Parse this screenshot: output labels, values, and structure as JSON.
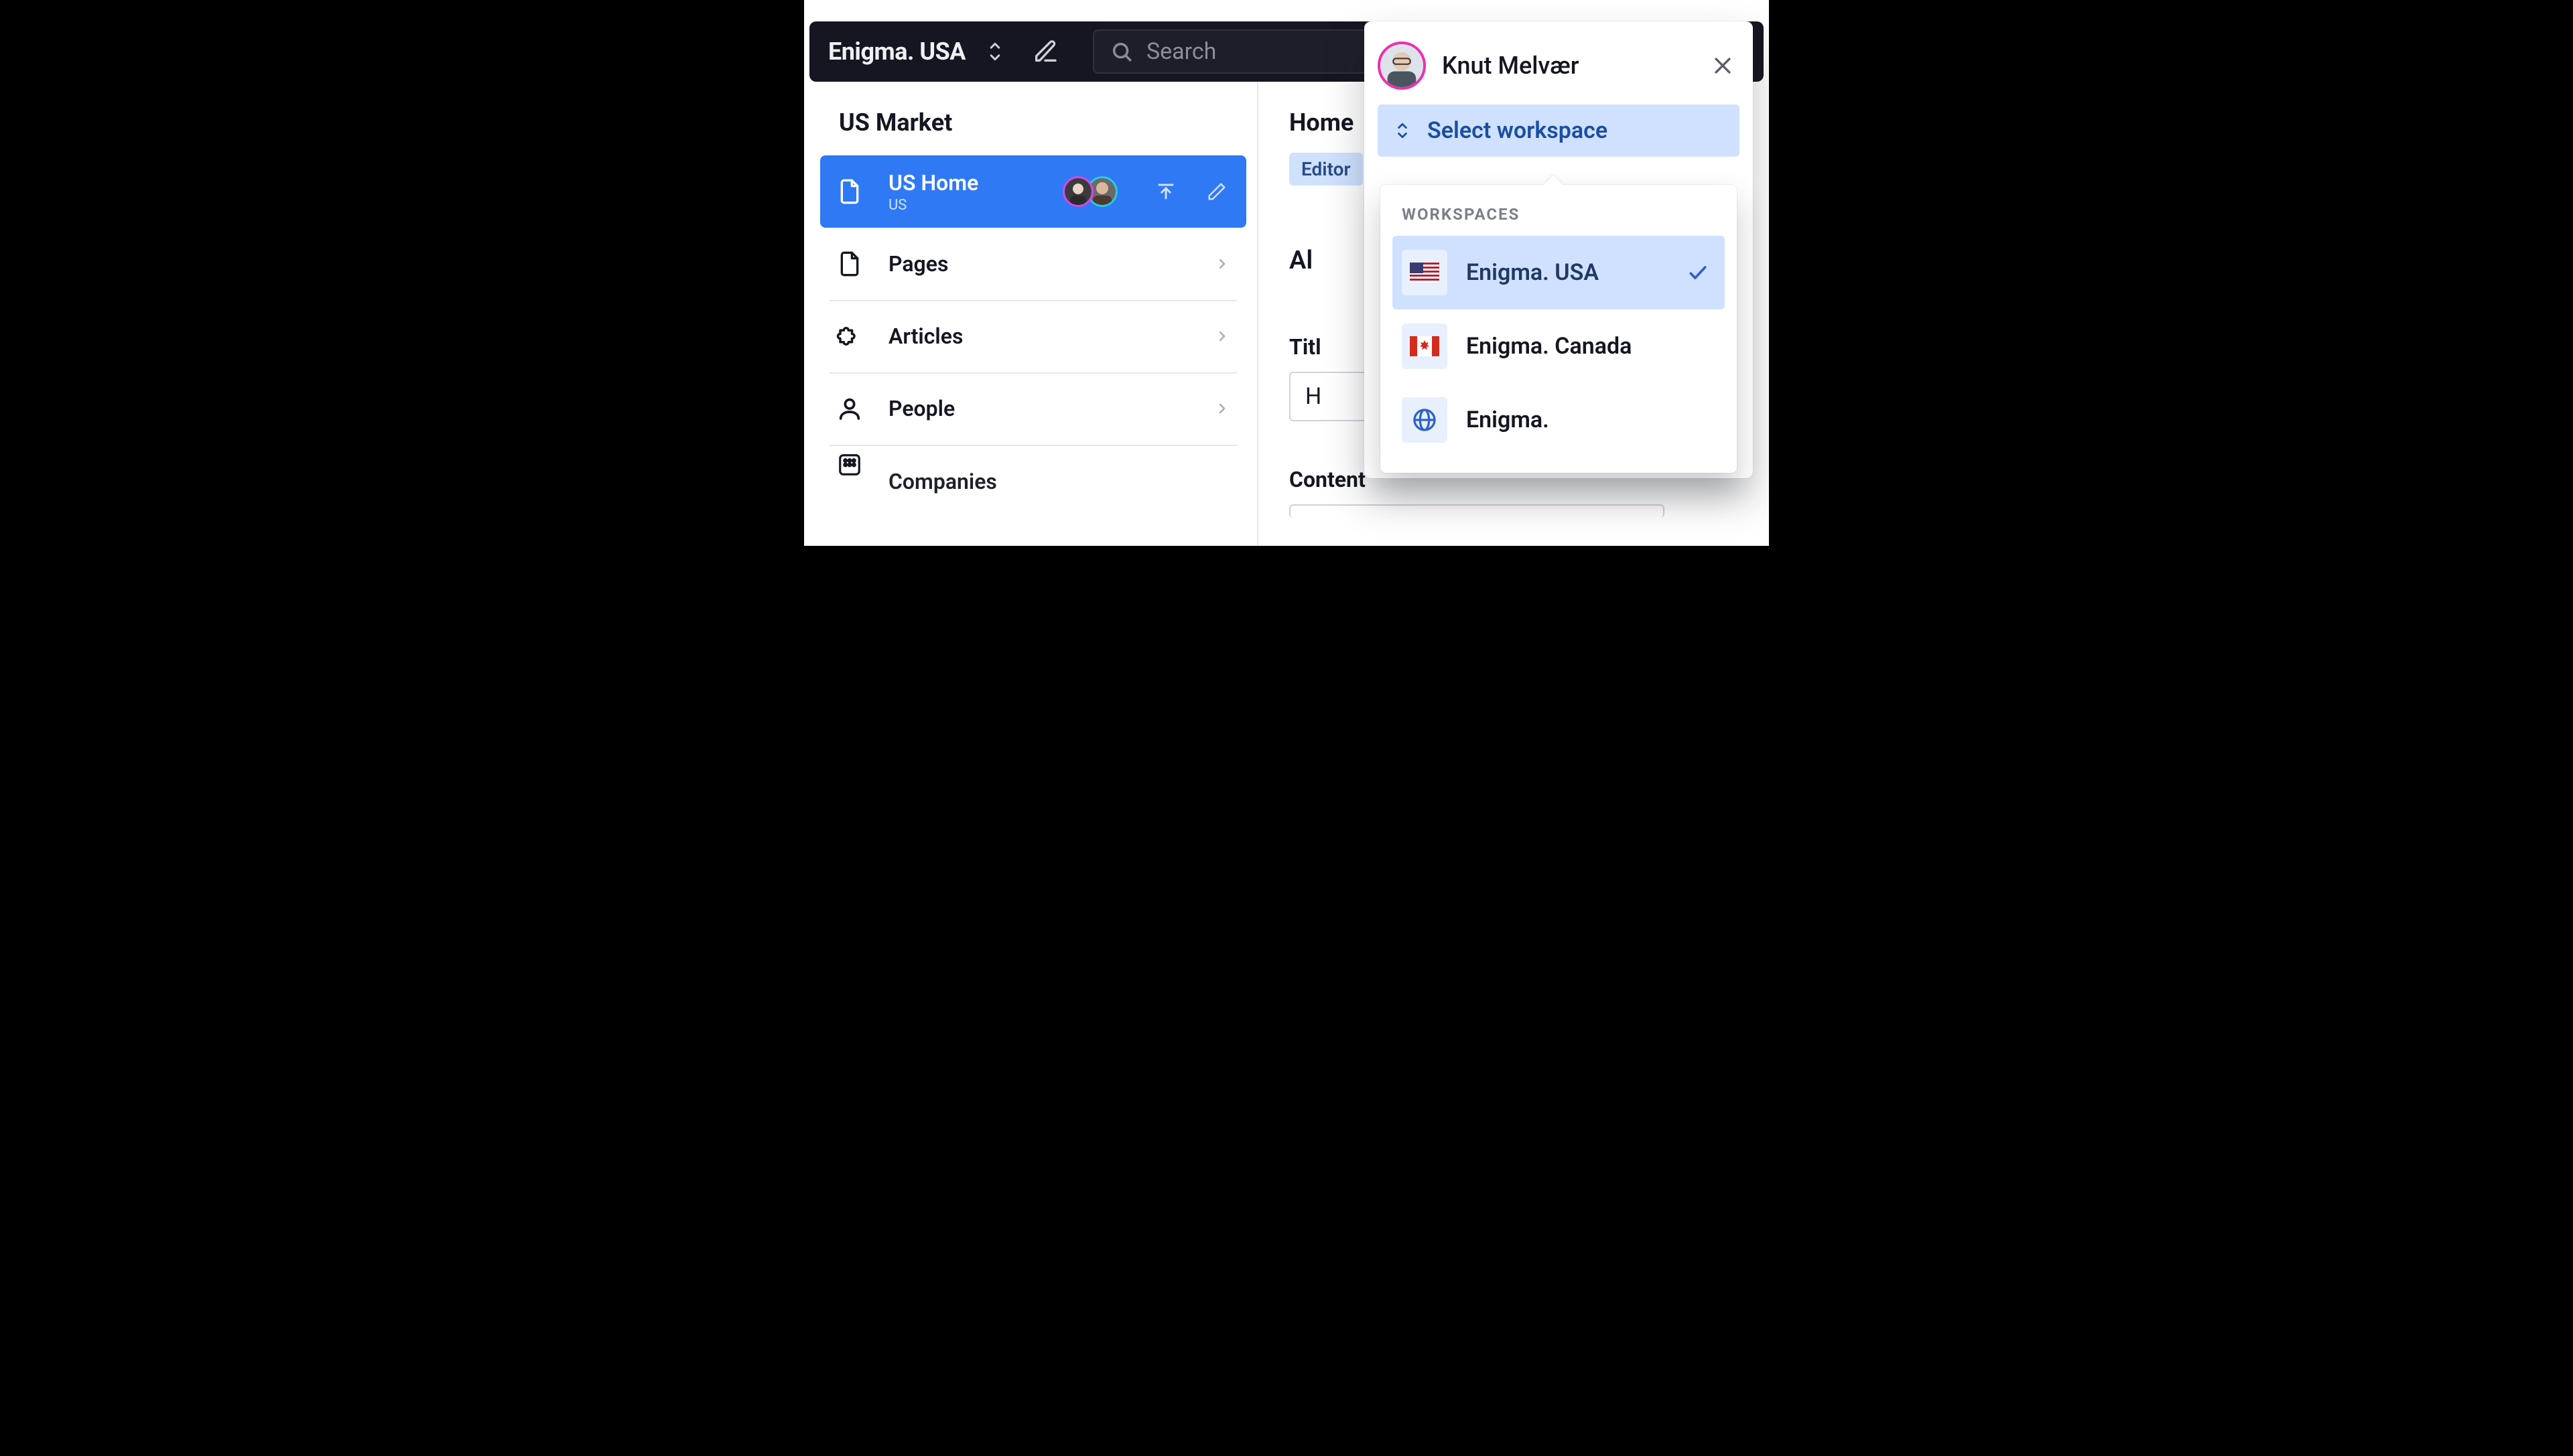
{
  "header": {
    "workspace_name": "Enigma. USA",
    "search_placeholder": "Search"
  },
  "sidebar": {
    "title": "US Market",
    "selected": {
      "title": "US Home",
      "subtitle": "US"
    },
    "items": [
      {
        "label": "Pages"
      },
      {
        "label": "Articles"
      },
      {
        "label": "People"
      },
      {
        "label": "Companies"
      }
    ]
  },
  "editor": {
    "title": "Home",
    "badge": "Editor",
    "truncated": "Al",
    "field1_label": "Titl",
    "field1_value": "H",
    "field2_label": "Content"
  },
  "popover": {
    "user_name": "Knut Melvær",
    "select_label": "Select workspace",
    "section_title": "WORKSPACES",
    "workspaces": [
      {
        "label": "Enigma. USA"
      },
      {
        "label": "Enigma. Canada"
      },
      {
        "label": "Enigma."
      }
    ]
  }
}
